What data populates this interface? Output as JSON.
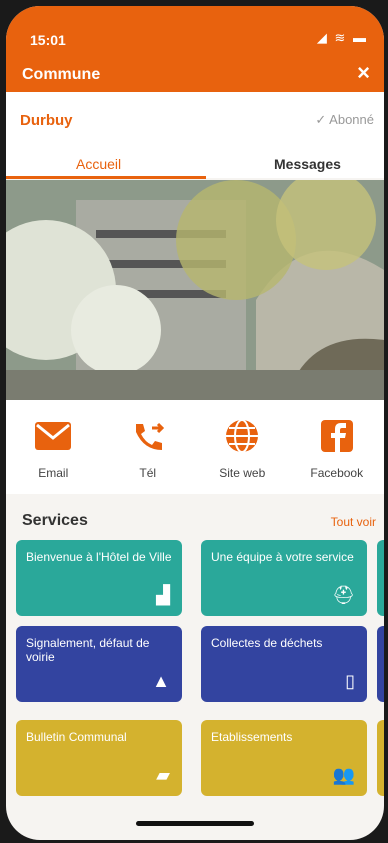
{
  "status": {
    "time": "15:01",
    "icons": "◢ ≋ ▬"
  },
  "nav": {
    "title": "Commune",
    "close_icon": "×"
  },
  "commune": {
    "name": "Durbuy",
    "subscribe_label": "✓ Abonné"
  },
  "tabs": [
    {
      "label": "Accueil",
      "active": true
    },
    {
      "label": "Messages",
      "active": false
    }
  ],
  "actions": [
    {
      "label": "Email",
      "icon": "mail-icon"
    },
    {
      "label": "Tél",
      "icon": "phone-forward-icon"
    },
    {
      "label": "Site web",
      "icon": "globe-icon"
    },
    {
      "label": "Facebook",
      "icon": "facebook-icon"
    }
  ],
  "services": {
    "title": "Services",
    "see_all": "Tout voir",
    "cards": [
      {
        "label": "Bienvenue à l'Hôtel de Ville",
        "icon": "building-icon",
        "color": "#2aa89a"
      },
      {
        "label": "Une équipe à votre service",
        "icon": "helmet-icon",
        "color": "#2aa89a"
      },
      {
        "label": "Signalement, défaut de voirie",
        "icon": "warning-icon",
        "color": "#3344a0"
      },
      {
        "label": "Collectes de déchets",
        "icon": "bin-icon",
        "color": "#3344a0"
      },
      {
        "label": "Bulletin Communal",
        "icon": "folder-icon",
        "color": "#d4b22e"
      },
      {
        "label": "Etablissements",
        "icon": "people-icon",
        "color": "#d4b22e"
      }
    ]
  },
  "colors": {
    "accent": "#e8620e",
    "teal": "#2aa89a",
    "blue": "#3344a0",
    "yellow": "#d4b22e"
  }
}
